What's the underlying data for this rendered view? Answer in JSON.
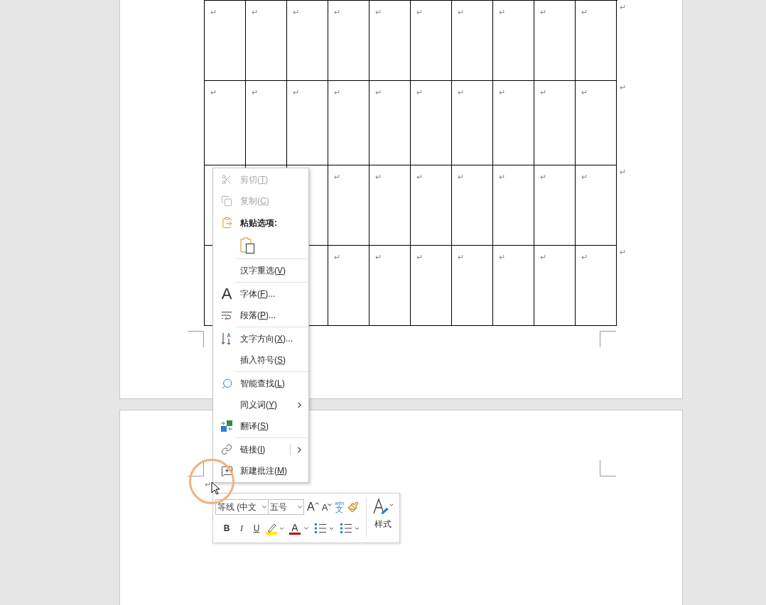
{
  "table": {
    "rows": [
      {
        "cells": [
          "↵",
          "↵",
          "↵",
          "↵",
          "↵",
          "↵",
          "↵",
          "↵",
          "↵",
          "↵"
        ],
        "end_mark": "↵"
      },
      {
        "cells": [
          "↵",
          "↵",
          "↵",
          "↵",
          "↵",
          "↵",
          "↵",
          "↵",
          "↵",
          "↵"
        ],
        "end_mark": "↵"
      },
      {
        "cells": [
          null,
          null,
          null,
          "↵",
          "↵",
          "↵",
          "↵",
          "↵",
          "↵",
          "↵"
        ],
        "end_mark": "↵"
      },
      {
        "cells": [
          null,
          null,
          null,
          "↵",
          "↵",
          "↵",
          "↵",
          "↵",
          "↵",
          "↵"
        ],
        "end_mark": "↵"
      }
    ]
  },
  "page2": {
    "mark": "↵"
  },
  "context_menu": {
    "items": [
      {
        "kind": "item",
        "label": "剪切(",
        "key": "T",
        "rest": ")",
        "disabled": true,
        "submenu": false
      },
      {
        "kind": "item",
        "label": "复制(",
        "key": "C",
        "rest": ")",
        "disabled": true,
        "submenu": false
      },
      {
        "kind": "header",
        "label": "粘贴选项:"
      },
      {
        "kind": "paste"
      },
      {
        "kind": "separator"
      },
      {
        "kind": "item",
        "label": "汉字重选(",
        "key": "V",
        "rest": ")",
        "disabled": false,
        "submenu": false
      },
      {
        "kind": "separator"
      },
      {
        "kind": "item",
        "glyph": "A",
        "label": "字体(",
        "key": "F",
        "rest": ")...",
        "disabled": false,
        "submenu": false
      },
      {
        "kind": "item",
        "label": "段落(",
        "key": "P",
        "rest": ")...",
        "disabled": false,
        "submenu": false
      },
      {
        "kind": "separator"
      },
      {
        "kind": "item",
        "label": "文字方向(",
        "key": "X",
        "rest": ")...",
        "disabled": false,
        "submenu": false
      },
      {
        "kind": "item",
        "label": "插入符号(",
        "key": "S",
        "rest": ")",
        "disabled": false,
        "submenu": false
      },
      {
        "kind": "separator"
      },
      {
        "kind": "item",
        "label": "智能查找(",
        "key": "L",
        "rest": ")",
        "disabled": false,
        "submenu": false
      },
      {
        "kind": "item",
        "label": "同义词(",
        "key": "Y",
        "rest": ")",
        "disabled": false,
        "submenu": true
      },
      {
        "kind": "item",
        "label": "翻译(",
        "key": "S",
        "rest": ")",
        "disabled": false,
        "submenu": false
      },
      {
        "kind": "separator"
      },
      {
        "kind": "item",
        "label": "链接(",
        "key": "I",
        "rest": ")",
        "disabled": false,
        "submenu": true
      },
      {
        "kind": "item",
        "label": "新建批注(",
        "key": "M",
        "rest": ")",
        "disabled": false,
        "submenu": false
      }
    ]
  },
  "mini_toolbar": {
    "font": "等线 (中文",
    "size": "五号",
    "grow": "A",
    "shrink": "A",
    "phonetic_top": "wén",
    "phonetic_bottom": "文",
    "bold": "B",
    "italic": "I",
    "underline": "U",
    "font_color": "A",
    "styles": "样式"
  }
}
